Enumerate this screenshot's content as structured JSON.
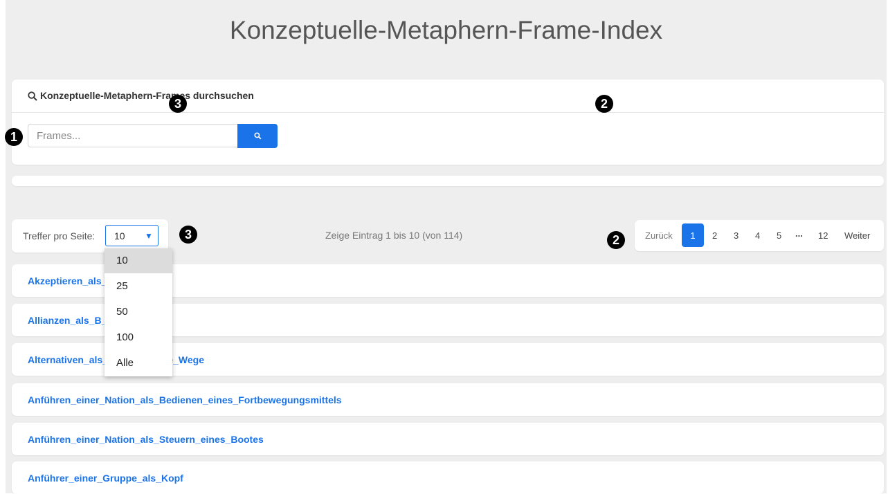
{
  "header": {
    "title": "Konzeptuelle-Metaphern-Frame-Index"
  },
  "search": {
    "heading": "Konzeptuelle-Metaphern-Frames durchsuchen",
    "placeholder": "Frames..."
  },
  "pagination_controls": {
    "per_page_label": "Treffer pro Seite:",
    "per_page_value": "10",
    "per_page_options": [
      "10",
      "25",
      "50",
      "100",
      "Alle"
    ],
    "info": "Zeige Eintrag 1 bis 10 (von 114)",
    "prev": "Zurück",
    "pages": [
      "1",
      "2",
      "3",
      "4",
      "5"
    ],
    "dots": "...",
    "last_page": "12",
    "next": "Weiter"
  },
  "results": [
    "Akzeptieren_als_",
    "Allianzen_als_B________en",
    "Alternativen_als__________ene_Wege",
    "Anführen_einer_Nation_als_Bedienen_eines_Fortbewegungsmittels",
    "Anführen_einer_Nation_als_Steuern_eines_Bootes",
    "Anführer_einer_Gruppe_als_Kopf"
  ],
  "markers": [
    "1",
    "2",
    "3",
    "3",
    "2"
  ],
  "colors": {
    "accent": "#1a73e8",
    "background": "#eeeeee"
  },
  "icons": {
    "search": "magnifier-icon",
    "select": "caret-down-icon"
  }
}
